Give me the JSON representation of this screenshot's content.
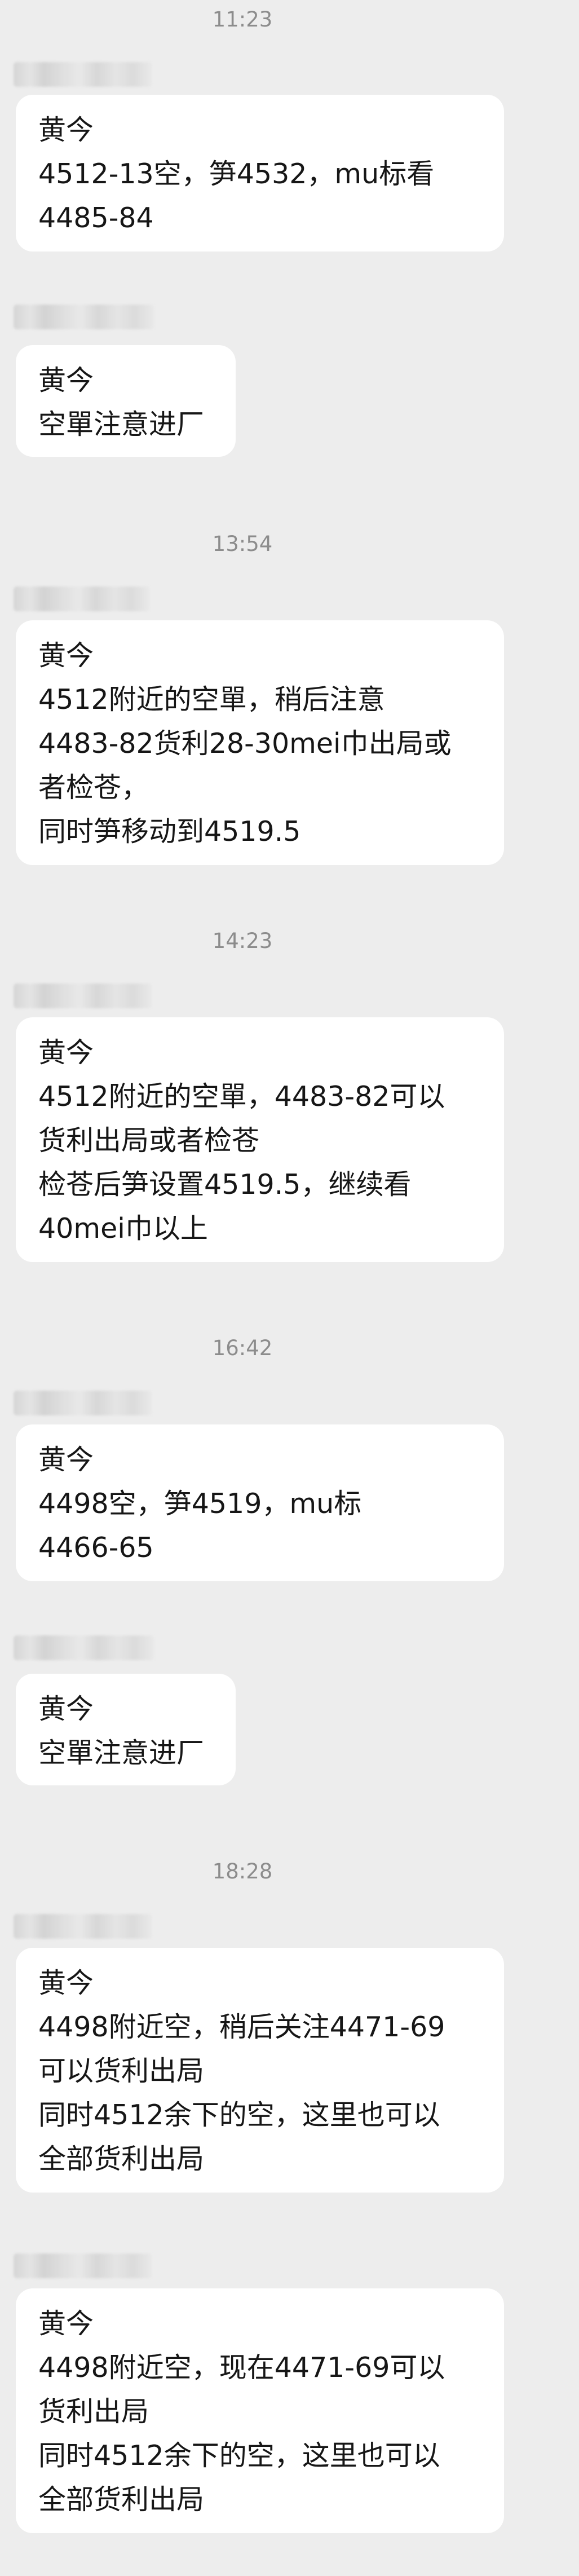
{
  "timestamps": [
    "11:23",
    "13:54",
    "14:23",
    "16:42",
    "18:28"
  ],
  "messages": [
    {
      "sender": "黄今",
      "lines": [
        "4512-13空，笋4532，mu标看",
        "4485-84"
      ]
    },
    {
      "sender": "黄今",
      "lines": [
        "空單注意进厂"
      ]
    },
    {
      "sender": "黄今",
      "lines": [
        "4512附近的空單，稍后注意",
        "4483-82货利28-30mei巾出局或",
        "者检苍，",
        "同时笋移动到4519.5"
      ]
    },
    {
      "sender": "黄今",
      "lines": [
        "4512附近的空單，4483-82可以",
        "货利出局或者检苍",
        "检苍后笋设置4519.5，继续看",
        "40mei巾以上"
      ]
    },
    {
      "sender": "黄今",
      "lines": [
        "4498空，笋4519，mu标",
        "4466-65"
      ]
    },
    {
      "sender": "黄今",
      "lines": [
        "空單注意进厂"
      ]
    },
    {
      "sender": "黄今",
      "lines": [
        "4498附近空，稍后关注4471-69",
        "可以货利出局",
        "同时4512余下的空，这里也可以",
        "全部货利出局"
      ]
    },
    {
      "sender": "黄今",
      "lines": [
        "4498附近空，现在4471-69可以",
        "货利出局",
        "同时4512余下的空，这里也可以",
        "全部货利出局"
      ]
    }
  ]
}
